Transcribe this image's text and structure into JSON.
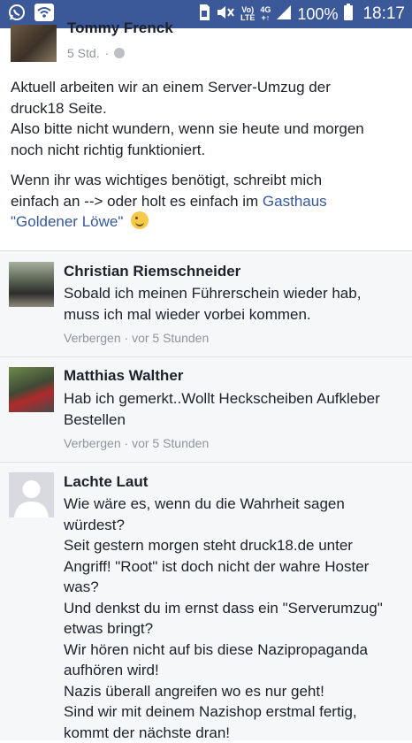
{
  "status_bar": {
    "battery_percent": "100%",
    "time": "18:17",
    "network_volte_line1": "Vo)",
    "network_volte_line2": "LTE",
    "network_4g_line1": "4G",
    "network_4g_line2": "+↑",
    "icons": [
      "whatsapp-icon",
      "wifi-icon",
      "sim-icon",
      "mute-icon",
      "signal-icon",
      "battery-icon"
    ]
  },
  "post": {
    "author": "Tommy Frenck",
    "time": "5 Std.",
    "separator": "·",
    "paragraph1": [
      "Aktuell arbeiten wir an einem Server-Umzug der",
      "druck18 Seite.",
      "Also bitte nicht wundern, wenn sie heute und morgen",
      "noch nicht richtig funktioniert."
    ],
    "paragraph2_line1": "Wenn ihr was wichtiges benötigt, schreibt mich",
    "paragraph2_line2_prefix": "einfach an --> oder holt es einfach im ",
    "paragraph2_link1": "Gasthaus",
    "paragraph2_link2": "\"Goldener Löwe\""
  },
  "comments": [
    {
      "author": "Christian Riemschneider",
      "lines": [
        "Sobald ich meinen Führerschein wieder hab,",
        "muss ich mal wieder vorbei kommen."
      ],
      "action": "Verbergen",
      "separator": "·",
      "time": "vor 5 Stunden"
    },
    {
      "author": "Matthias Walther",
      "lines": [
        "Hab ich gemerkt..Wollt Heckscheiben Aufkleber",
        "Bestellen"
      ],
      "action": "Verbergen",
      "separator": "·",
      "time": "vor 5 Stunden"
    },
    {
      "author": "Lachte Laut",
      "lines": [
        "Wie wäre es, wenn du die Wahrheit sagen",
        "würdest?",
        "Seit gestern morgen steht druck18.de unter",
        "Angriff! \"Root\" ist doch nicht der wahre Hoster",
        "was?",
        "Und denkst du im ernst dass ein \"Serverumzug\"",
        "etwas bringt?",
        "Wir hören nicht auf bis diese Nazipropaganda",
        "aufhören wird!",
        "Nazis überall angreifen wo es nur geht!",
        "Sind wir mit deinem Nazishop erstmal fertig,",
        "kommt der nächste dran!"
      ]
    }
  ],
  "colors": {
    "status_bar": "#3b5998",
    "link": "#365899",
    "meta": "#90949c",
    "comment_bg": "#f6f7f9"
  }
}
